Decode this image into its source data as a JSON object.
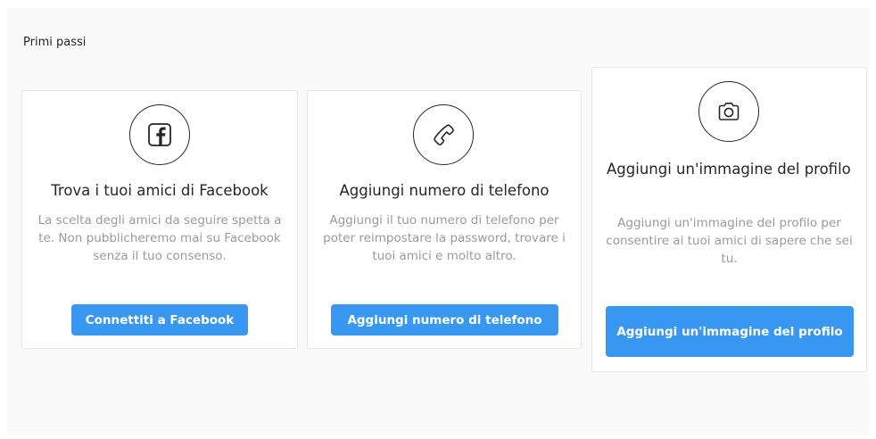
{
  "section": {
    "title": "Primi passi"
  },
  "cards": [
    {
      "icon": "facebook-icon",
      "title": "Trova i tuoi amici di Facebook",
      "description": "La scelta degli amici da seguire spetta a te. Non pubblicheremo mai su Facebook senza il tuo consenso.",
      "button_label": "Connettiti a Facebook"
    },
    {
      "icon": "phone-icon",
      "title": "Aggiungi numero di telefono",
      "description": "Aggiungi il tuo numero di telefono per poter reimpostare la password, trovare i tuoi amici e molto altro.",
      "button_label": "Aggiungi numero di telefono"
    },
    {
      "icon": "camera-icon",
      "title": "Aggiungi un'immagine del profilo",
      "description": "Aggiungi un'immagine del profilo per consentire ai tuoi amici di sapere che sei tu.",
      "button_label": "Aggiungi un'immagine del profilo"
    }
  ],
  "colors": {
    "button_background": "#3897f0",
    "button_text": "#ffffff",
    "panel_background": "#f9f9f9",
    "card_border": "#e6e6e6",
    "description_text": "#9a9a9a"
  }
}
